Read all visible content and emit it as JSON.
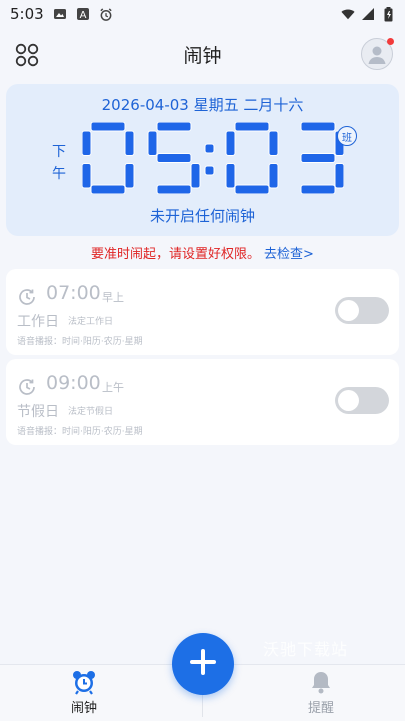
{
  "status_bar": {
    "time": "5:03",
    "icons": [
      "image-icon",
      "a-badge-icon",
      "alarm-clock-icon",
      "wifi-icon",
      "signal-icon",
      "battery-icon"
    ]
  },
  "header": {
    "title": "闹钟",
    "left_icon": "grid-apps-icon",
    "right_icon": "avatar-icon"
  },
  "clock": {
    "date_line": "2026-04-03 星期五 二月十六",
    "ampm": "下午",
    "digits": "05:03",
    "badge": "班",
    "status": "未开启任何闹钟"
  },
  "warning": {
    "text": "要准时闹起，请设置好权限。",
    "link": "去检查>"
  },
  "alarms": [
    {
      "time": "07:00",
      "ampm": "早上",
      "name": "工作日",
      "tag": "法定工作日",
      "voice": "语音播报：时间·阳历·农历·星期",
      "enabled": false
    },
    {
      "time": "09:00",
      "ampm": "上午",
      "name": "节假日",
      "tag": "法定节假日",
      "voice": "语音播报：时间·阳历·农历·星期",
      "enabled": false
    }
  ],
  "watermark": "沃驰下载站",
  "fab": {
    "icon": "plus-icon"
  },
  "bottom_nav": [
    {
      "label": "闹钟",
      "icon": "alarm-clock-icon",
      "active": true
    },
    {
      "label": "提醒",
      "icon": "bell-icon",
      "active": false
    }
  ],
  "colors": {
    "accent": "#1e63d6",
    "digit_fill": "#1f66e8",
    "warning": "#e02525",
    "card_bg": "#e3edfb",
    "page_bg": "#f4f6fb",
    "disabled_text": "#b9bec7"
  }
}
